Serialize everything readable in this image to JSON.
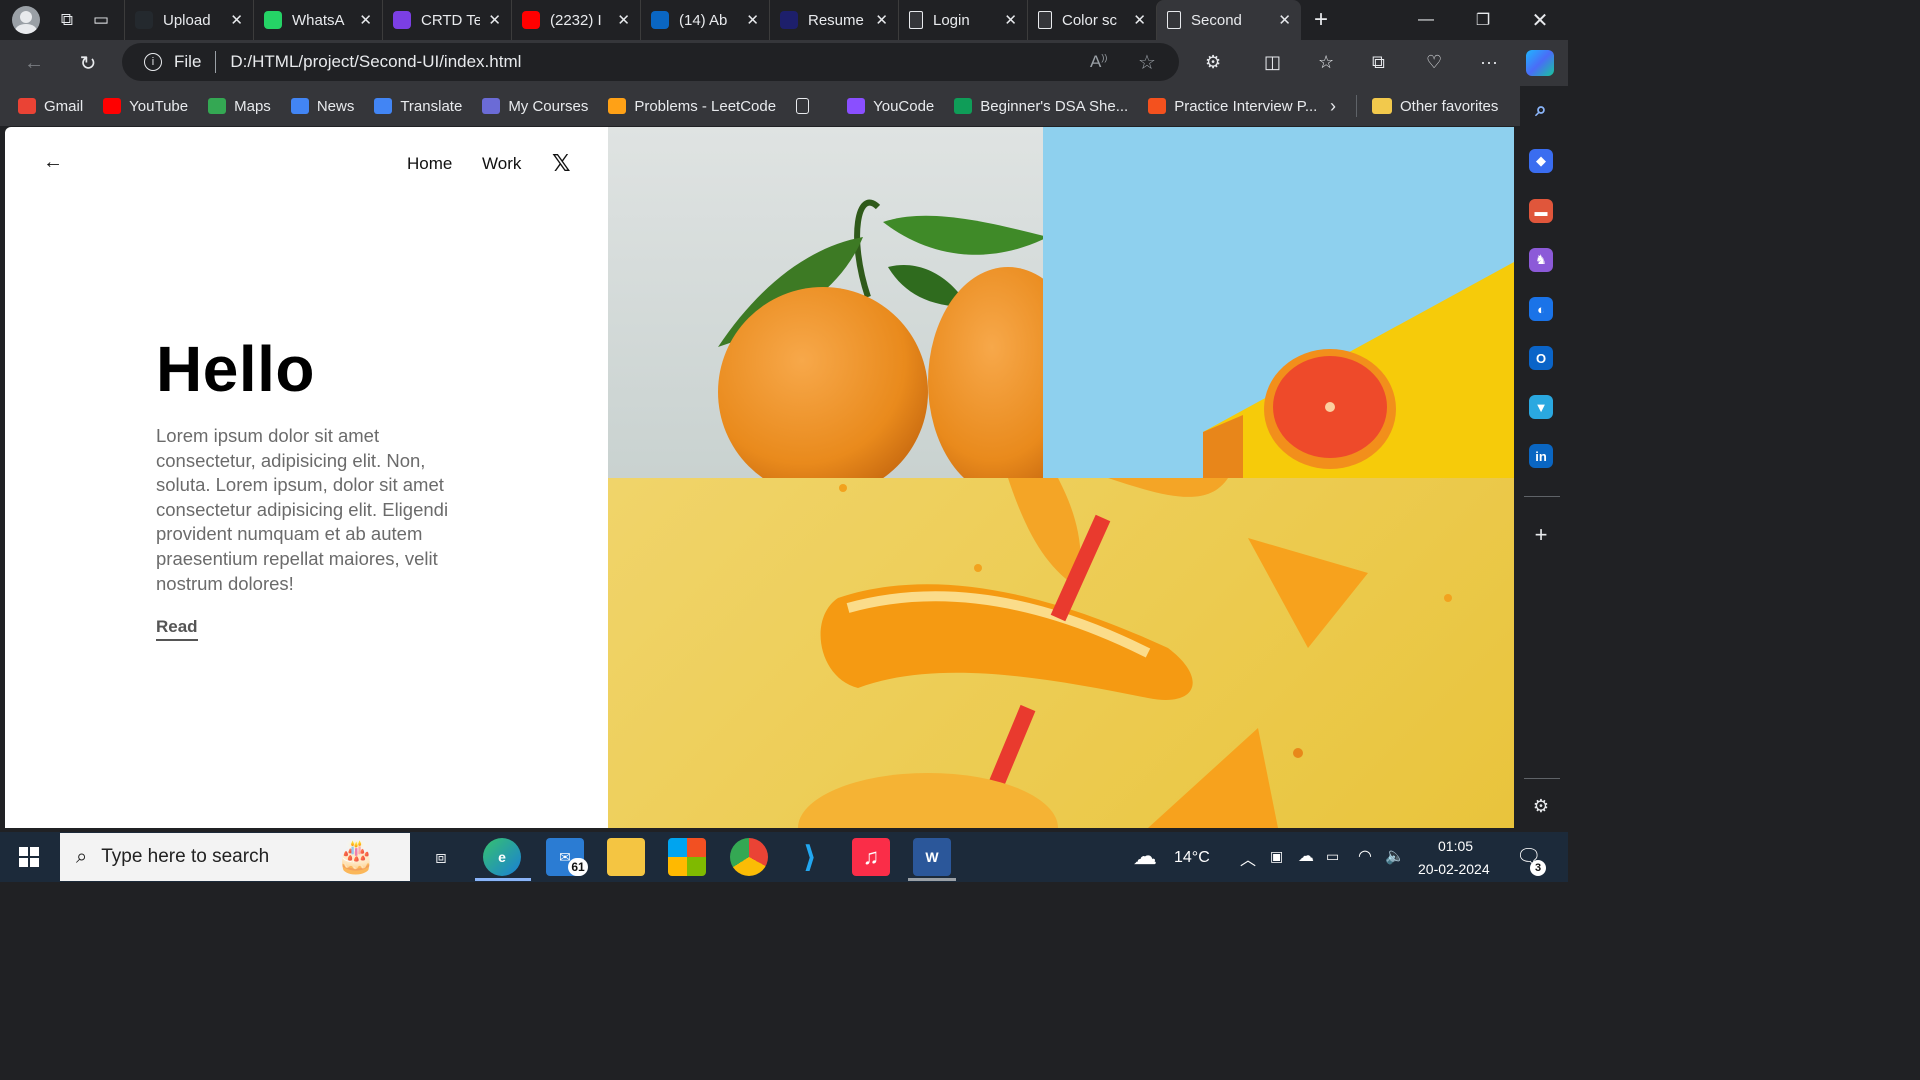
{
  "browser": {
    "tabs": [
      {
        "title": "Upload",
        "icon": "github-icon",
        "color": "#24292e"
      },
      {
        "title": "WhatsA",
        "icon": "whatsapp-icon",
        "color": "#25d366"
      },
      {
        "title": "CRTD Te",
        "icon": "list-icon",
        "color": "#7b3fe4"
      },
      {
        "title": "(2232) I",
        "icon": "youtube-icon",
        "color": "#ff0000"
      },
      {
        "title": "(14) Ab",
        "icon": "linkedin-icon",
        "color": "#0a66c2"
      },
      {
        "title": "Resume",
        "icon": "resume-r-icon",
        "color": "#1d1f6b"
      },
      {
        "title": "Login",
        "icon": "page-icon",
        "color": "#35363a"
      },
      {
        "title": "Color sc",
        "icon": "page-icon",
        "color": "#35363a"
      },
      {
        "title": "Second",
        "icon": "page-icon",
        "color": "#35363a",
        "active": true
      }
    ],
    "address": {
      "scheme_label": "File",
      "url": "D:/HTML/project/Second-UI/index.html"
    },
    "bookmarks": [
      {
        "label": "Gmail",
        "icon": "gmail-icon",
        "color": "#ea4335"
      },
      {
        "label": "YouTube",
        "icon": "youtube-icon",
        "color": "#ff0000"
      },
      {
        "label": "Maps",
        "icon": "maps-pin-icon",
        "color": "#34a853"
      },
      {
        "label": "News",
        "icon": "news-icon",
        "color": "#4285f4"
      },
      {
        "label": "Translate",
        "icon": "translate-icon",
        "color": "#4285f4"
      },
      {
        "label": "My Courses",
        "icon": "courses-icon",
        "color": "#6b6bd6"
      },
      {
        "label": "Problems - LeetCode",
        "icon": "leetcode-icon",
        "color": "#ffa116"
      },
      {
        "label": "",
        "icon": "page-icon",
        "color": "#35363a"
      },
      {
        "label": "YouCode",
        "icon": "youcode-icon",
        "color": "#8a4fff"
      },
      {
        "label": "Beginner's DSA She...",
        "icon": "sheet-plus-icon",
        "color": "#0f9d58"
      },
      {
        "label": "Practice Interview P...",
        "icon": "practice-icon",
        "color": "#f4511e"
      }
    ],
    "other_favorites": "Other favorites"
  },
  "site": {
    "nav": {
      "home": "Home",
      "work": "Work"
    },
    "hero": {
      "title": "Hello",
      "body": "Lorem ipsum dolor sit amet consectetur, adipisicing elit. Non, soluta. Lorem ipsum, dolor sit amet consectetur adipisicing elit. Eligendi provident numquam et ab autem praesentium repellat maiores, velit nostrum dolores!",
      "cta": "Read"
    }
  },
  "taskbar": {
    "search_placeholder": "Type here to search",
    "mail_badge": "61",
    "weather": "14°C",
    "time": "01:05",
    "date": "20-02-2024",
    "notifications": "3"
  }
}
